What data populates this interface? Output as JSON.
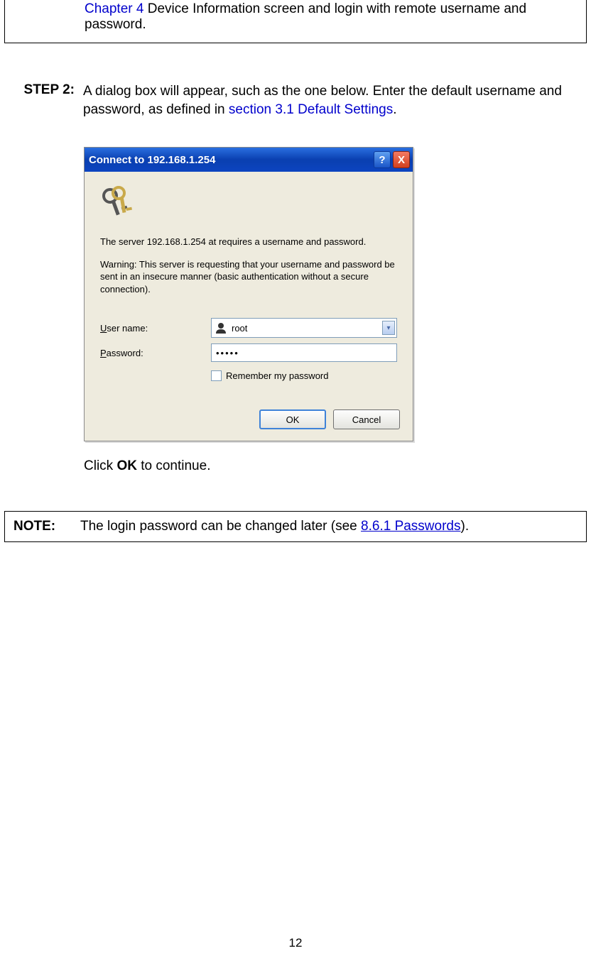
{
  "topBox": {
    "link": "Chapter 4",
    "rest": " Device Information screen and login with remote username and password."
  },
  "step": {
    "label": "STEP 2:",
    "text_before": "A dialog box will appear, such as the one below.  Enter the default username and password, as defined in ",
    "link": "section 3.1 Default Settings",
    "text_after": "."
  },
  "dialog": {
    "title": "Connect to 192.168.1.254",
    "help_symbol": "?",
    "close_symbol": "X",
    "msg1": "The server 192.168.1.254 at   requires a username and password.",
    "msg2": "Warning: This server is requesting that your username and password be sent in an insecure manner (basic authentication without a secure connection).",
    "username_label_u": "U",
    "username_label_rest": "ser name:",
    "username_value": "root",
    "dropdown_glyph": "▾",
    "password_label_u": "P",
    "password_label_rest": "assword:",
    "password_value": "•••••",
    "remember_u": "R",
    "remember_rest": "emember my password",
    "ok": "OK",
    "cancel": "Cancel"
  },
  "after": {
    "prefix": "Click ",
    "bold": "OK",
    "suffix": " to continue."
  },
  "note": {
    "label": "NOTE:",
    "text_before": "The login password can be changed later (see ",
    "link": "8.6.1 Passwords",
    "text_after": ")."
  },
  "pageNumber": "12"
}
